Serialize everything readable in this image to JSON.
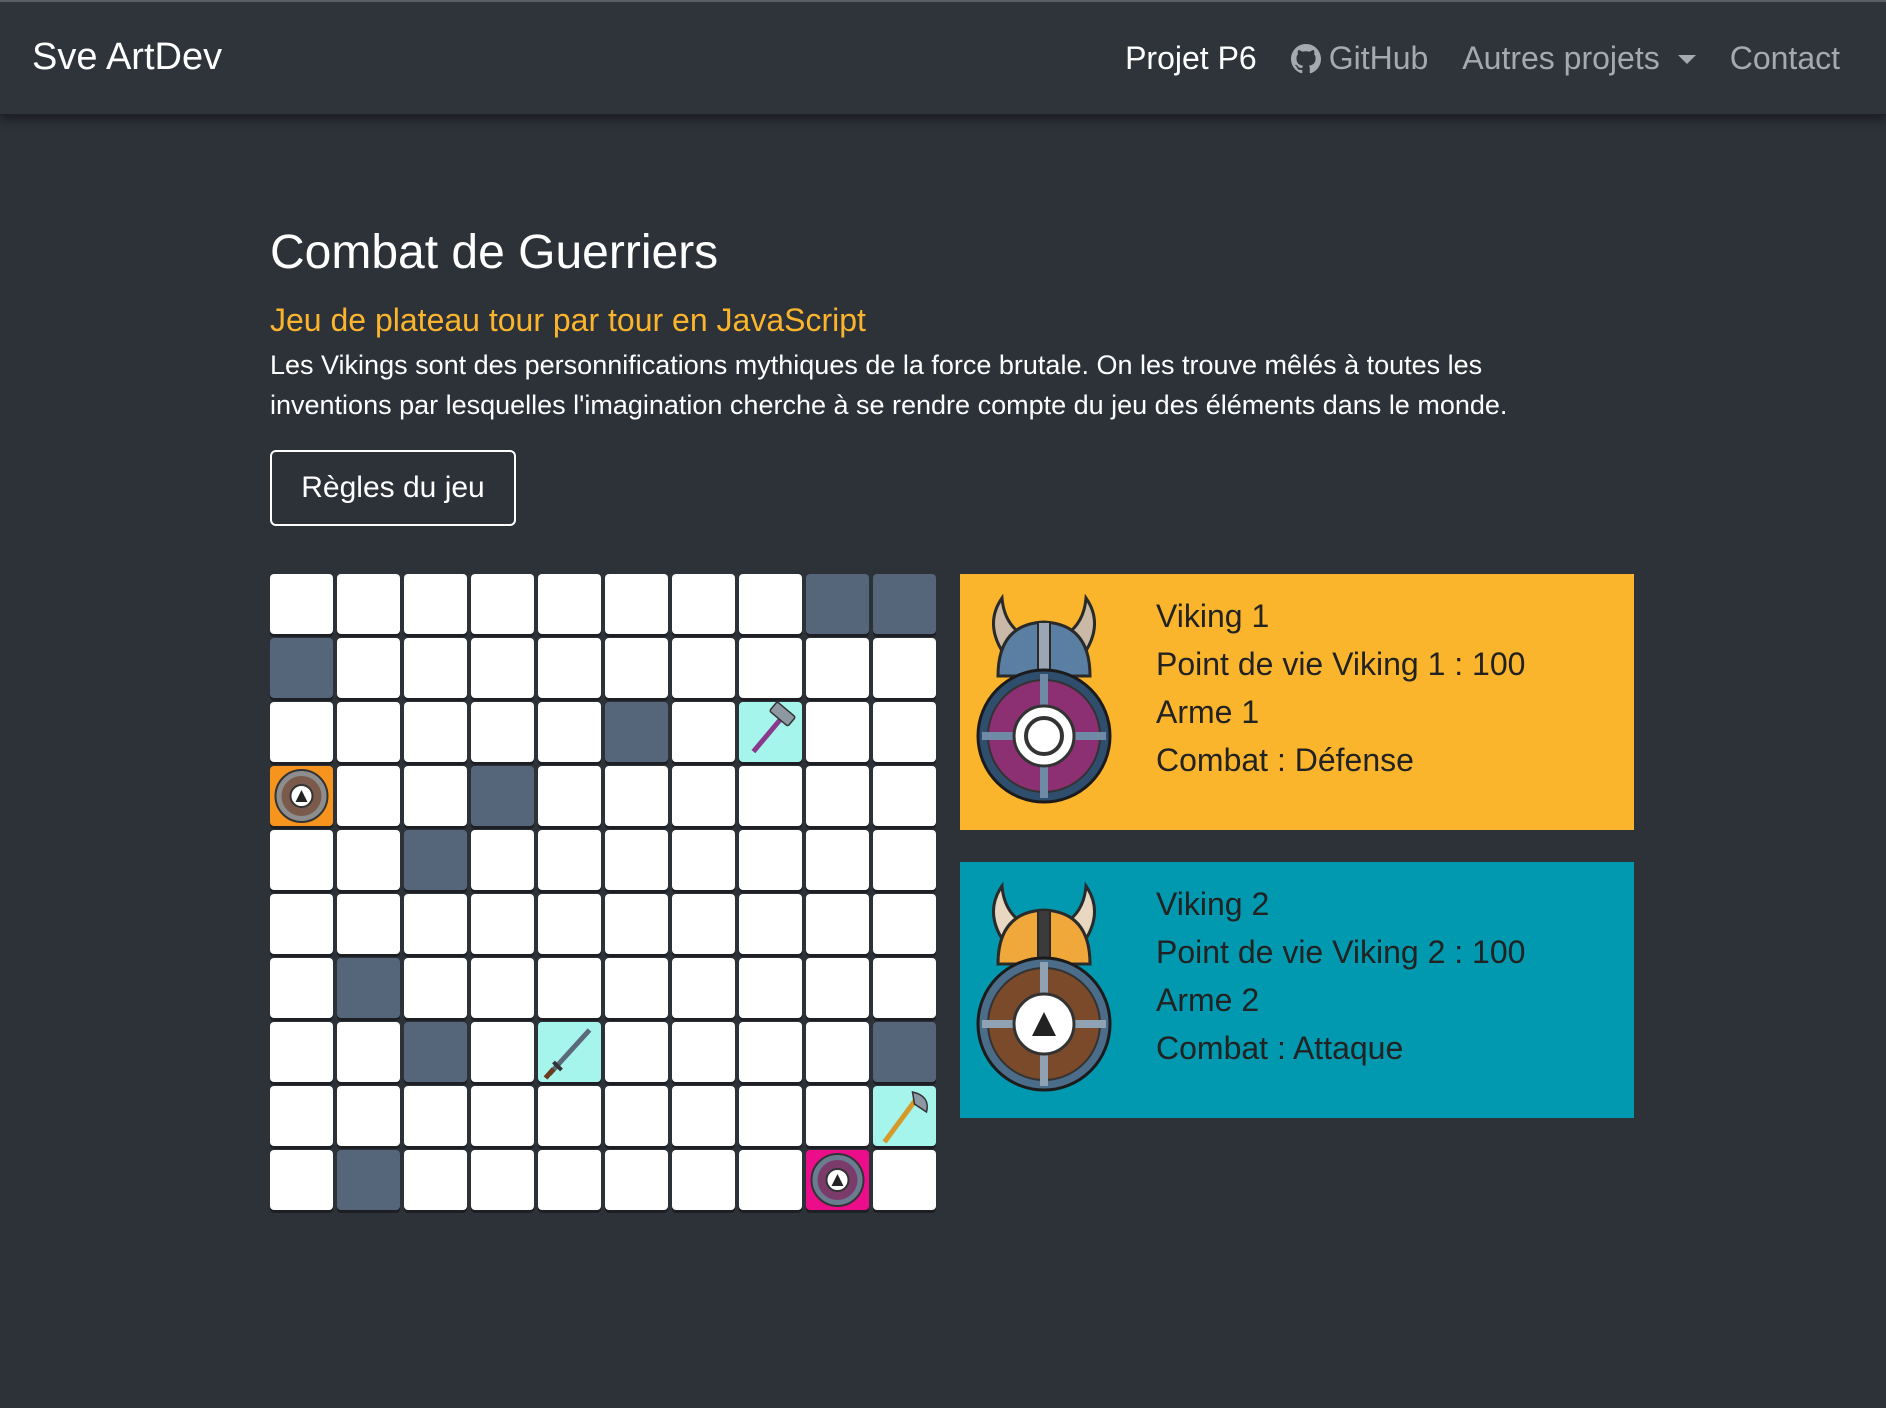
{
  "navbar": {
    "brand": "Sve ArtDev",
    "links": [
      {
        "label": "Projet P6",
        "active": true
      },
      {
        "label": "GitHub",
        "icon": "github-icon"
      },
      {
        "label": "Autres projets",
        "dropdown": true
      },
      {
        "label": "Contact"
      }
    ]
  },
  "header": {
    "title": "Combat de Guerriers",
    "subtitle": "Jeu de plateau tour par tour en JavaScript",
    "description": "Les Vikings sont des personnifications mythiques de la force brutale. On les trouve mêlés à toutes les inventions par lesquelles l'imagination cherche à se rendre compte du jeu des éléments dans le monde.",
    "rules_button": "Règles du jeu"
  },
  "board": {
    "size": 10,
    "legend": {
      ".": "empty",
      "#": "blocked",
      "H": "hammer",
      "S": "sword",
      "A": "axe",
      "1": "viking-1",
      "2": "viking-2"
    },
    "rows": [
      "........##",
      "#.........",
      ".....#.H..",
      "1..#......",
      "..#.......",
      "..........",
      ".#........",
      "..#.S....#",
      ".........A",
      ".#......2."
    ]
  },
  "players": [
    {
      "name": "Viking 1",
      "hp_text": "Point de vie Viking 1 : 100",
      "weapon": "Arme 1",
      "combat": "Combat : Défense",
      "color": "#fbb52d",
      "avatar": "viking-helmet-shield-icon"
    },
    {
      "name": "Viking 2",
      "hp_text": "Point de vie Viking 2 : 100",
      "weapon": "Arme 2",
      "combat": "Combat : Attaque",
      "color": "#0199b0",
      "avatar": "viking-helmet-shield-icon"
    }
  ],
  "colors": {
    "background": "#2d3138",
    "accent": "#fbb52d",
    "blocked_cell": "#55667b",
    "weapon_cell": "#a5f5ec",
    "player1_cell": "#f7941d",
    "player2_cell": "#ec0d8a"
  }
}
